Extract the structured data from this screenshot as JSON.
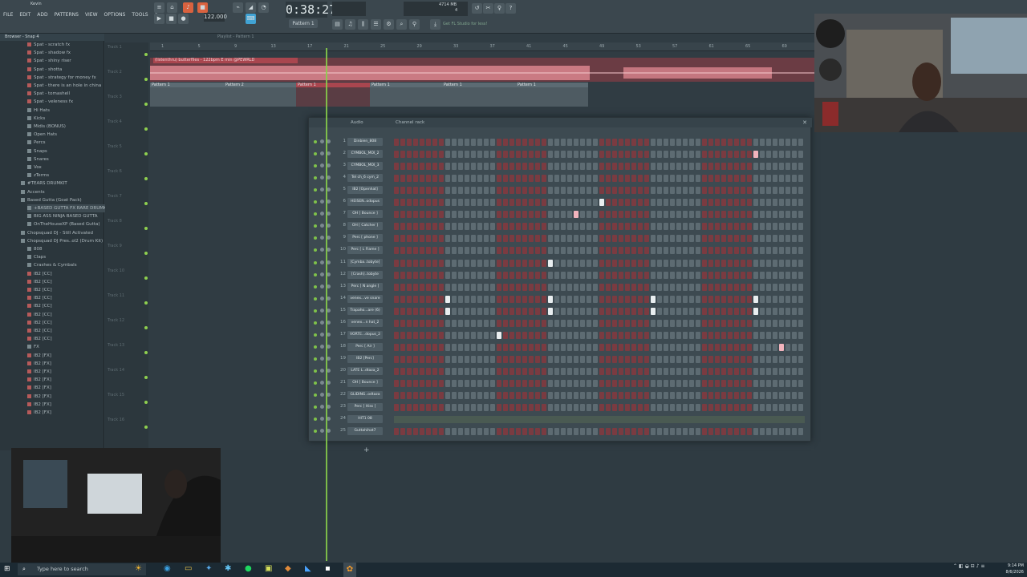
{
  "window": {
    "title": "Kevin"
  },
  "menu": [
    "FILE",
    "EDIT",
    "ADD",
    "PATTERNS",
    "VIEW",
    "OPTIONS",
    "TOOLS",
    "?"
  ],
  "transport": {
    "time": "0:38:27",
    "tempo": "122.000",
    "pattern": "Pattern 1",
    "cpu": "4714 MB",
    "cpu_threads": "4"
  },
  "hint": "Get FL Studio for less!",
  "browser": {
    "header": "Browser - Snap 4",
    "items": [
      "Spat - scratch fx",
      "Spat - shadow fx",
      "Spat - shiny riser",
      "Spat - shotta",
      "Spat - strategy for money fx",
      "Spat - there is an hole in china",
      "Spat - tomashell",
      "Spat - veleness fx",
      "Hi Hats",
      "Kicks",
      "Midis (BONUS)",
      "Open Hats",
      "Percs",
      "Snaps",
      "Snares",
      "Vox",
      "zTerms",
      "#TEARS DRUMKIT",
      "Accents",
      "Based Gutta (Goat Pack)",
      "+BASED GUTTA FX RARE DRUMKIT [TRAP ARCHIVE]",
      "BIG ASS NINJA BASED GUTTA",
      "OnTheHouseXP (Based Gutta)",
      "Chopsquad DJ - Still Activated",
      "Chopsquad DJ Pres..ol2 (Drum Kit)",
      "808",
      "Claps",
      "Crashes & Cymbals",
      "IB2 [CC]",
      "IB2 [CC]",
      "IB2 [CC]",
      "IB2 [CC]",
      "IB2 [CC]",
      "IB2 [CC]",
      "IB2 [CC]",
      "IB2 [CC]",
      "IB2 [CC]",
      "FX",
      "IB2 [FX]",
      "IB2 [FX]",
      "IB2 [FX]",
      "IB2 [FX]",
      "IB2 [FX]",
      "IB2 [FX]",
      "IB2 [FX]",
      "IB2 [FX]"
    ]
  },
  "playlist": {
    "title": "Playlist - Pattern 1",
    "audio_clip": "(listenthru) butterflies - 122bpm E min @PEWRLD",
    "patterns": [
      "Pattern 1",
      "Pattern 2",
      "Pattern 1",
      "Pattern 1",
      "Pattern 1",
      "Pattern 1"
    ],
    "ruler": [
      "1",
      "5",
      "9",
      "13",
      "17",
      "21",
      "25",
      "29",
      "33",
      "37",
      "41",
      "45",
      "49",
      "53",
      "57",
      "61",
      "65",
      "69"
    ],
    "tracks": [
      "Track 1",
      "Track 2",
      "Track 3",
      "Track 4",
      "Track 5",
      "Track 6",
      "Track 7",
      "Track 8",
      "Track 9",
      "Track 10",
      "Track 11",
      "Track 12",
      "Track 13",
      "Track 14",
      "Track 15",
      "Track 16"
    ]
  },
  "rack": {
    "title": "Channel rack",
    "group": "Audio",
    "channels": [
      {
        "n": "1",
        "name": "Dinbien_808"
      },
      {
        "n": "2",
        "name": "CYMBOL_MOI_2"
      },
      {
        "n": "3",
        "name": "CYMBOL_MOI_3"
      },
      {
        "n": "4",
        "name": "Tel ch_6 cym_2"
      },
      {
        "n": "5",
        "name": "IB2 [Openhat]"
      },
      {
        "n": "6",
        "name": "HEISEN..odopus"
      },
      {
        "n": "7",
        "name": "OH [ Bounce ]"
      },
      {
        "n": "8",
        "name": "OH [ Catcher ]"
      },
      {
        "n": "9",
        "name": "Perc [ phone ]"
      },
      {
        "n": "10",
        "name": "Perc [ L Flame ]"
      },
      {
        "n": "11",
        "name": "[Cymba..tobyte]"
      },
      {
        "n": "12",
        "name": "[Crash]..tobyte"
      },
      {
        "n": "13",
        "name": "Perc [ N angle ]"
      },
      {
        "n": "14",
        "name": "venex...ve snare"
      },
      {
        "n": "15",
        "name": "Trapaho...are (6)"
      },
      {
        "n": "16",
        "name": "venex...n hat_2"
      },
      {
        "n": "17",
        "name": "VORTE...dopus_2"
      },
      {
        "n": "18",
        "name": "Perc [ Air ]"
      },
      {
        "n": "19",
        "name": "IB2 [Perc]"
      },
      {
        "n": "20",
        "name": "LATE L..dtaza_2"
      },
      {
        "n": "21",
        "name": "OH [ Bounce ]"
      },
      {
        "n": "22",
        "name": "GLIDING..odtaza"
      },
      {
        "n": "23",
        "name": "Perc [ Hiss ]"
      },
      {
        "n": "24",
        "name": "HIT1 08"
      },
      {
        "n": "25",
        "name": "Guttahihat7"
      }
    ],
    "steps_on": {
      "2": [
        [
          28,
          "p"
        ],
        [
          32,
          "p"
        ]
      ],
      "3": [
        [
          34,
          "w"
        ]
      ],
      "6": [
        [
          16,
          "w"
        ]
      ],
      "7": [
        [
          14,
          "p"
        ]
      ],
      "10": [
        [
          34,
          "w"
        ]
      ],
      "11": [
        [
          12,
          "w"
        ]
      ],
      "14": [
        [
          4,
          "w"
        ],
        [
          12,
          "w"
        ],
        [
          20,
          "w"
        ],
        [
          28,
          "w"
        ]
      ],
      "15": [
        [
          4,
          "w"
        ],
        [
          12,
          "w"
        ],
        [
          20,
          "w"
        ],
        [
          28,
          "w"
        ]
      ],
      "17": [
        [
          8,
          "w"
        ]
      ],
      "18": [
        [
          30,
          "p"
        ]
      ]
    }
  },
  "taskbar": {
    "search": "Type here to search",
    "time": "9:14 PM",
    "date": "8/6/2026"
  },
  "colors": {
    "accent_green": "#8ad24a",
    "step_red": "#7a3b41",
    "step_grey": "#5d6b72"
  }
}
